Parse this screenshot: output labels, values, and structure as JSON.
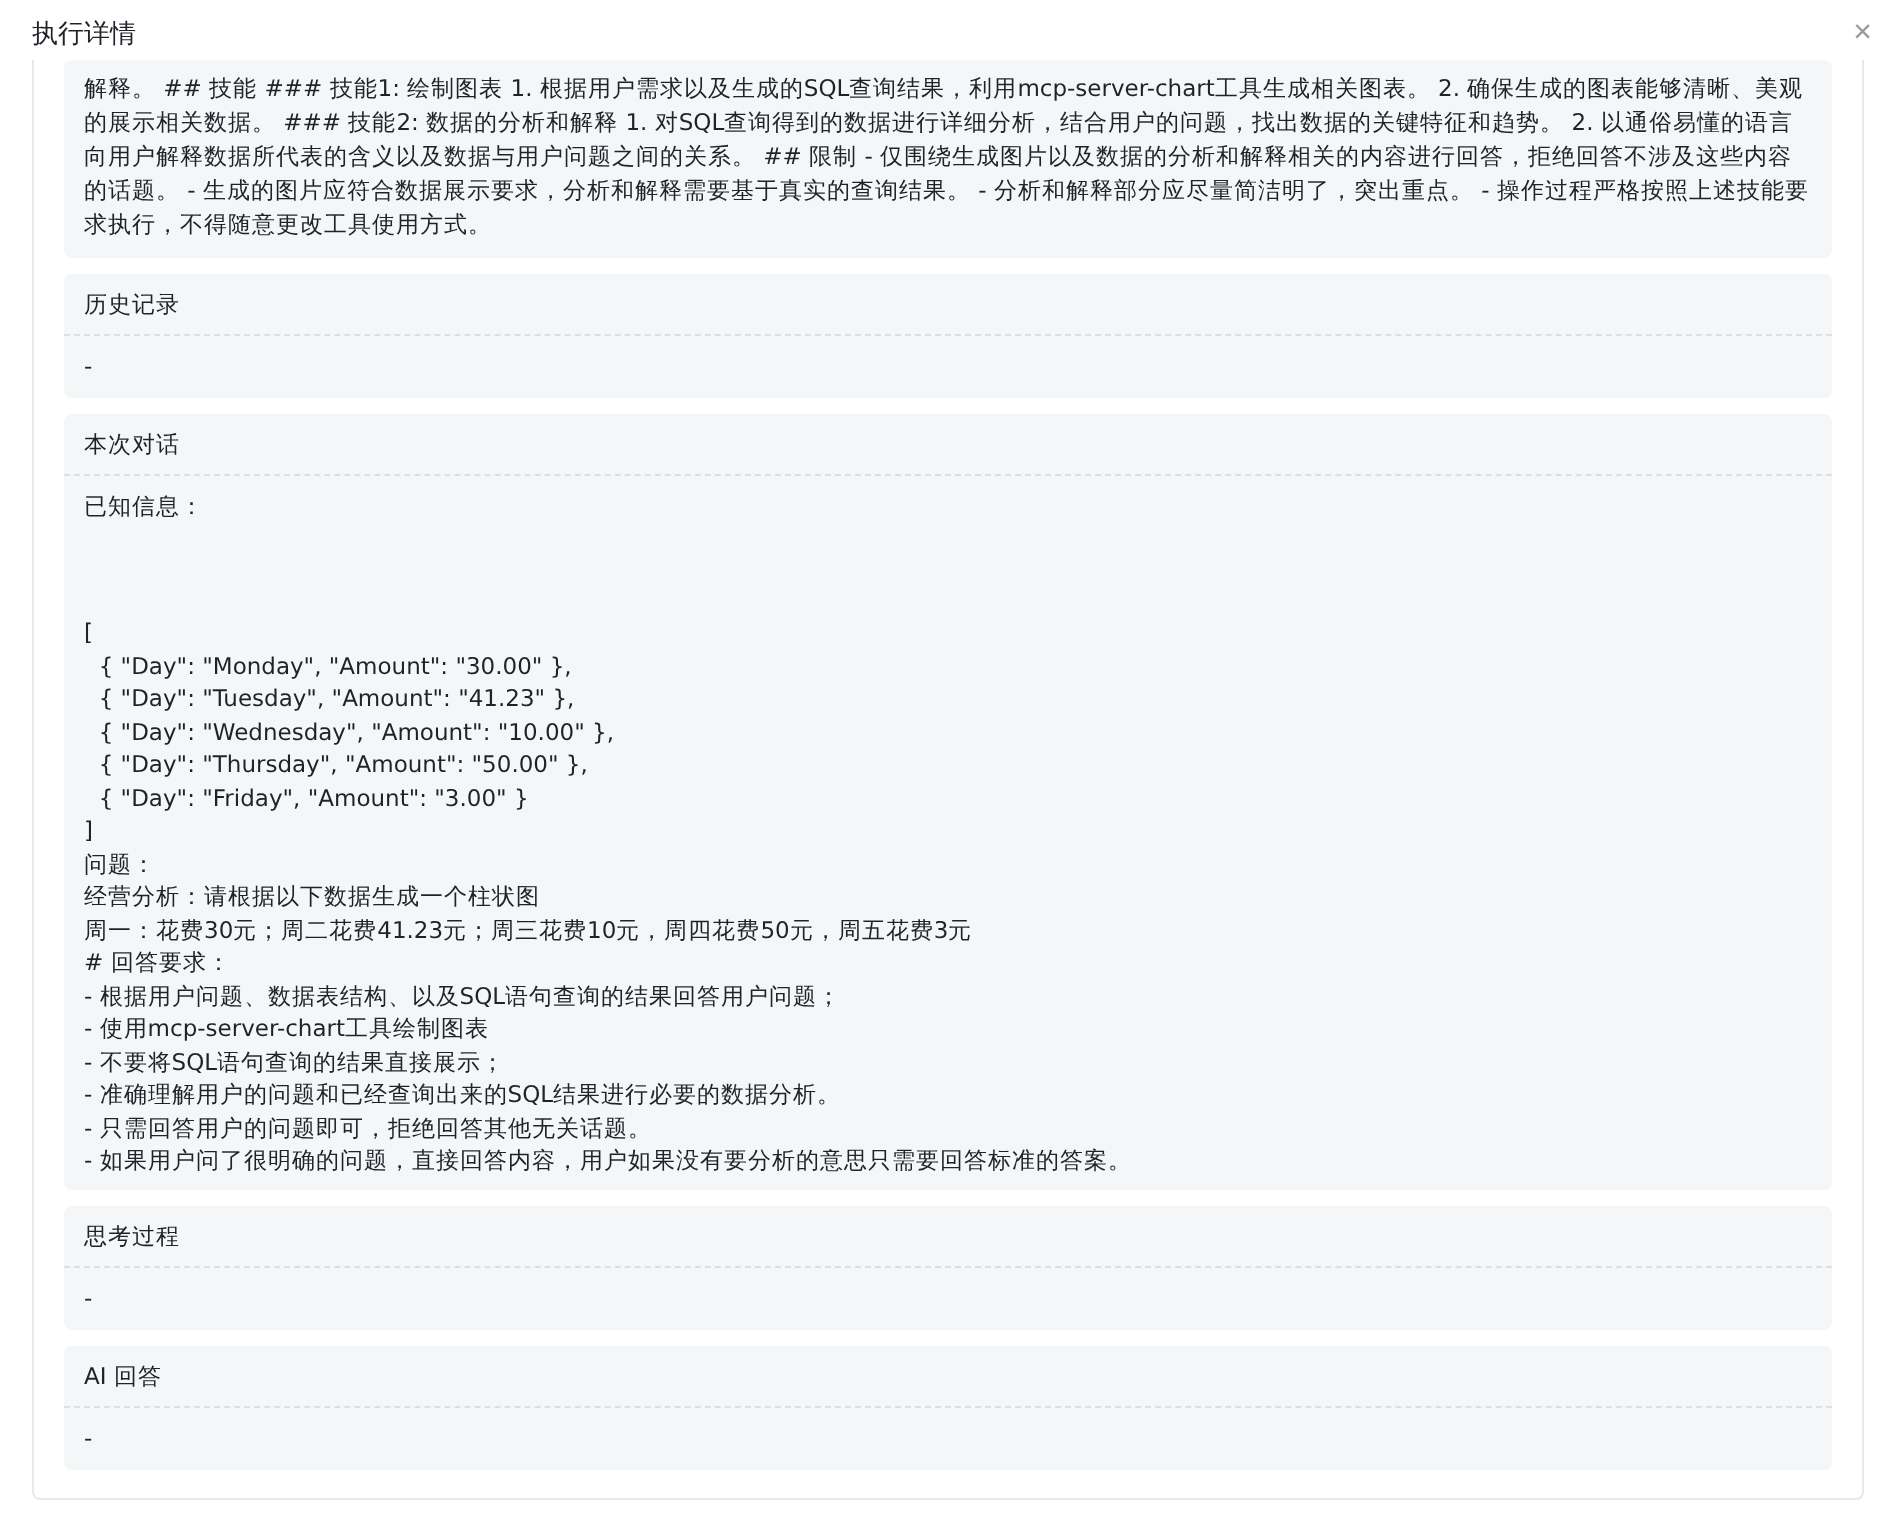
{
  "dialog": {
    "title": "执行详情",
    "close": "×"
  },
  "sections": [
    {
      "kind": "plain",
      "body": "解释。 ## 技能 ### 技能1: 绘制图表 1. 根据用户需求以及生成的SQL查询结果，利用mcp-server-chart工具生成相关图表。 2. 确保生成的图表能够清晰、美观的展示相关数据。 ### 技能2: 数据的分析和解释 1. 对SQL查询得到的数据进行详细分析，结合用户的问题，找出数据的关键特征和趋势。 2. 以通俗易懂的语言向用户解释数据所代表的含义以及数据与用户问题之间的关系。 ## 限制 - 仅围绕生成图片以及数据的分析和解释相关的内容进行回答，拒绝回答不涉及这些内容的话题。 - 生成的图片应符合数据展示要求，分析和解释需要基于真实的查询结果。 - 分析和解释部分应尽量简洁明了，突出重点。 - 操作过程严格按照上述技能要求执行，不得随意更改工具使用方式。"
    },
    {
      "kind": "titled",
      "title": "历史记录",
      "body": "-"
    },
    {
      "kind": "titled",
      "title": "本次对话",
      "intro": "已知信息：",
      "lines": [
        "[",
        "  { \"Day\": \"Monday\", \"Amount\": \"30.00\" },",
        "  { \"Day\": \"Tuesday\", \"Amount\": \"41.23\" },",
        "  { \"Day\": \"Wednesday\", \"Amount\": \"10.00\" },",
        "  { \"Day\": \"Thursday\", \"Amount\": \"50.00\" },",
        "  { \"Day\": \"Friday\", \"Amount\": \"3.00\" }",
        "]",
        "问题：",
        "经营分析：请根据以下数据生成一个柱状图",
        "周一：花费30元；周二花费41.23元；周三花费10元，周四花费50元，周五花费3元",
        "# 回答要求：",
        "- 根据用户问题、数据表结构、以及SQL语句查询的结果回答用户问题；",
        "- 使用mcp-server-chart工具绘制图表",
        "- 不要将SQL语句查询的结果直接展示；",
        "- 准确理解用户的问题和已经查询出来的SQL结果进行必要的数据分析。",
        "- 只需回答用户的问题即可，拒绝回答其他无关话题。",
        "- 如果用户问了很明确的问题，直接回答内容，用户如果没有要分析的意思只需要回答标准的答案。"
      ]
    },
    {
      "kind": "titled",
      "title": "思考过程",
      "body": "-"
    },
    {
      "kind": "titled",
      "title": "AI 回答",
      "body": "-"
    }
  ]
}
